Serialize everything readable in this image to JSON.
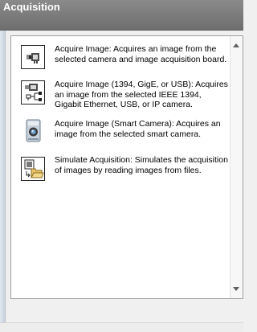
{
  "window": {
    "title": "Acquisition"
  },
  "items": [
    {
      "icon": "camera-board-icon",
      "text": "Acquire Image:  Acquires an image from the selected camera and image acquisition board."
    },
    {
      "icon": "network-camera-icon",
      "text": "Acquire Image (1394, GigE, or USB): Acquires an image from the selected IEEE 1394, Gigabit Ethernet, USB, or IP camera."
    },
    {
      "icon": "smart-camera-icon",
      "text": "Acquire Image (Smart Camera):  Acquires an image from the selected smart camera."
    },
    {
      "icon": "simulate-folder-icon",
      "text": "Simulate Acquisition:  Simulates the acquisition of images by reading images from files."
    }
  ]
}
